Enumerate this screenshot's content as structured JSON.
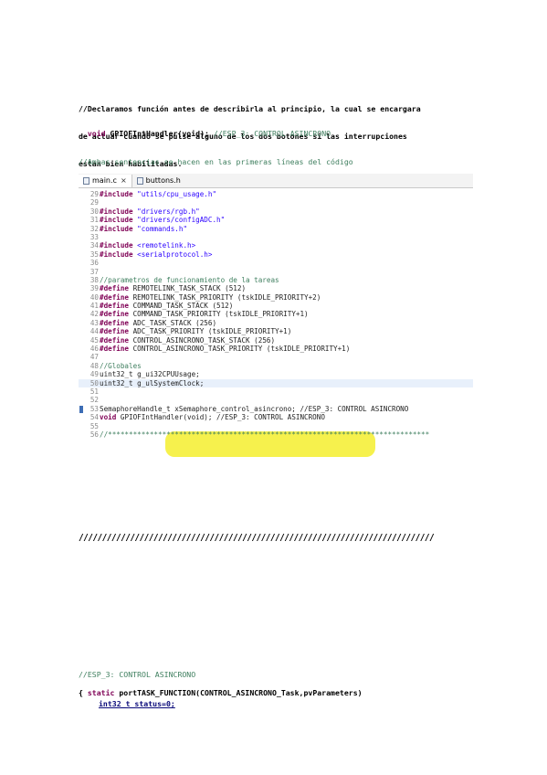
{
  "intro": {
    "line1": "//Declaramos función antes de describirla al principio, la cual se encargara",
    "line2": "de actuar cuando se pulse alguno de los dos botones si las interrupciones",
    "line3": "estan bien habilitadas.",
    "code_kw": "void",
    "code_name": " GPIOFIntHandler(void); ",
    "code_comment": "//ESP_3: CONTROL ASINCRONO"
  },
  "comment2": "//Ambas sentencias se hacen en las primeras líneas del código",
  "ide": {
    "tabs": [
      {
        "label": "main.c",
        "close": "×"
      },
      {
        "label": "buttons.h"
      }
    ],
    "lines": [
      {
        "n": "29",
        "kw": "#include",
        "rest": " \"utils/cpu_usage.h\""
      },
      {
        "n": "29",
        "kw": "",
        "rest": ""
      },
      {
        "n": "30",
        "kw": "#include",
        "rest": " \"drivers/rgb.h\""
      },
      {
        "n": "31",
        "kw": "#include",
        "rest": " \"drivers/configADC.h\""
      },
      {
        "n": "32",
        "kw": "#include",
        "rest": " \"commands.h\""
      },
      {
        "n": "33",
        "kw": "",
        "rest": ""
      },
      {
        "n": "34",
        "kw": "#include",
        "rest": " <remotelink.h>"
      },
      {
        "n": "35",
        "kw": "#include",
        "rest": " <serialprotocol.h>"
      },
      {
        "n": "36",
        "kw": "",
        "rest": ""
      },
      {
        "n": "37",
        "kw": "",
        "rest": ""
      },
      {
        "n": "38",
        "kw": "",
        "rest": "//parametros de funcionamiento de la tareas"
      },
      {
        "n": "39",
        "kw": "#define",
        "rest": " REMOTELINK_TASK_STACK (512)"
      },
      {
        "n": "40",
        "kw": "#define",
        "rest": " REMOTELINK_TASK_PRIORITY (tskIDLE_PRIORITY+2)"
      },
      {
        "n": "41",
        "kw": "#define",
        "rest": " COMMAND_TASK_STACK (512)"
      },
      {
        "n": "42",
        "kw": "#define",
        "rest": " COMMAND_TASK_PRIORITY (tskIDLE_PRIORITY+1)"
      },
      {
        "n": "43",
        "kw": "#define",
        "rest": " ADC_TASK_STACK (256)"
      },
      {
        "n": "44",
        "kw": "#define",
        "rest": " ADC_TASK_PRIORITY (tskIDLE_PRIORITY+1)"
      },
      {
        "n": "45",
        "kw": "#define",
        "rest": " CONTROL_ASINCRONO_TASK_STACK (256)"
      },
      {
        "n": "46",
        "kw": "#define",
        "rest": " CONTROL_ASINCRONO_TASK_PRIORITY (tskIDLE_PRIORITY+1)"
      },
      {
        "n": "47",
        "kw": "",
        "rest": ""
      },
      {
        "n": "48",
        "kw": "",
        "rest": "//Globales"
      },
      {
        "n": "49",
        "kw": "",
        "rest": "uint32_t g_ui32CPUUsage;"
      },
      {
        "n": "50",
        "kw": "",
        "rest": "uint32_t g_ulSystemClock;"
      },
      {
        "n": "51",
        "kw": "",
        "rest": ""
      },
      {
        "n": "52",
        "kw": "",
        "rest": ""
      },
      {
        "n": "53",
        "kw": "",
        "rest": "SemaphoreHandle_t xSemaphore_control_asincrono; //ESP_3: CONTROL ASINCRONO"
      },
      {
        "n": "54",
        "kw": "void",
        "rest": " GPIOFIntHandler(void); //ESP_3: CONTROL ASINCRONO"
      },
      {
        "n": "55",
        "kw": "",
        "rest": ""
      },
      {
        "n": "56",
        "kw": "",
        "rest": "//*****************************************************************************"
      }
    ]
  },
  "separator": "////////////////////////////////////////////////////////////////////////////",
  "bottom": {
    "line1": "//ESP_3: CONTROL ASINCRONO",
    "line2_kw": "static",
    "line2_rest": " portTASK_FUNCTION(CONTROL_ASINCRONO_Task,pvParameters)",
    "line3": "{",
    "line4": "int32_t status=0;"
  }
}
